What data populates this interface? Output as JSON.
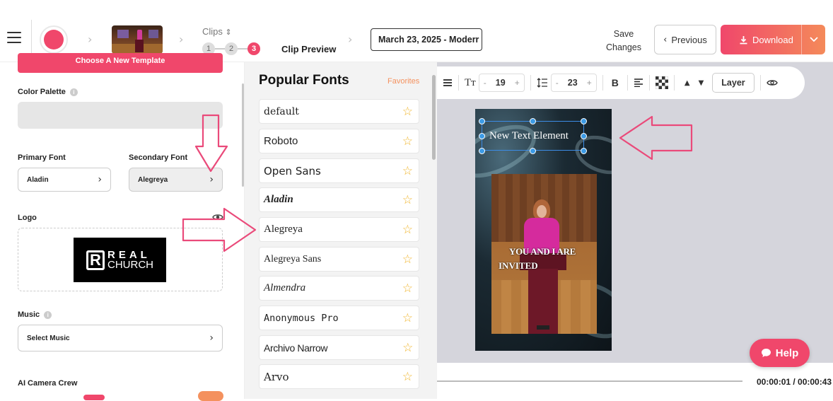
{
  "header": {
    "clips_label": "Clips",
    "steps": [
      "1",
      "2",
      "3"
    ],
    "active_step_label": "Clip Preview",
    "date_title": "March 23, 2025 - Moderr",
    "save_changes_line1": "Save",
    "save_changes_line2": "Changes",
    "previous_label": "Previous",
    "download_label": "Download",
    "accent": "#f0476b"
  },
  "sidebar": {
    "template_button": "Choose A New Template",
    "color_palette_label": "Color Palette",
    "primary_font_label": "Primary Font",
    "primary_font_value": "Aladin",
    "secondary_font_label": "Secondary Font",
    "secondary_font_value": "Alegreya",
    "logo_label": "Logo",
    "logo_text_line1": "REAL",
    "logo_text_line2": "CHURCH",
    "logo_mark": "R",
    "music_label": "Music",
    "music_select": "Select Music",
    "ai_camera_label": "AI Camera Crew"
  },
  "fonts_panel": {
    "title": "Popular Fonts",
    "favorites": "Favorites",
    "fonts": [
      "default",
      "Roboto",
      "Open Sans",
      "Aladin",
      "Alegreya",
      "Alegreya Sans",
      "Almendra",
      "Anonymous Pro",
      "Archivo Narrow",
      "Arvo"
    ]
  },
  "toolbar": {
    "font_size": "19",
    "line_height": "23",
    "bold": "B",
    "layer_label": "Layer"
  },
  "canvas": {
    "text_element": "New Text Element",
    "caption_line1": "YOU AND I ARE",
    "caption_line2": "INVITED"
  },
  "help_label": "Help",
  "time_readout": "00:00:01 / 00:00:43"
}
